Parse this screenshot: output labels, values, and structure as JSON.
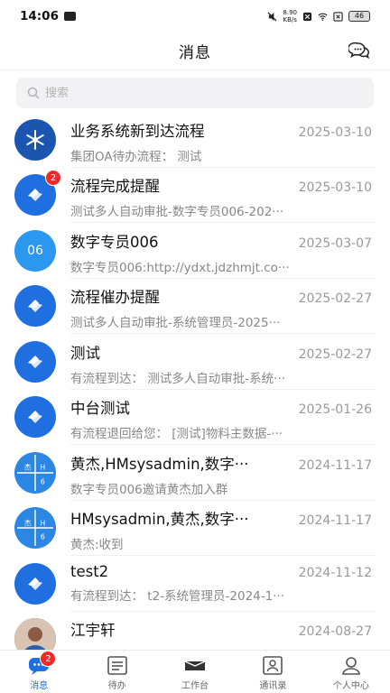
{
  "status_bar": {
    "time": "14:06",
    "speed_value": "8.90",
    "speed_unit": "KB/s",
    "battery": "46"
  },
  "header": {
    "title": "消息"
  },
  "search": {
    "placeholder": "搜索"
  },
  "messages": [
    {
      "title": "业务系统新到达流程",
      "date": "2025-03-10",
      "preview": "集团OA待办流程： 测试",
      "avatar": "snowflake",
      "badge": ""
    },
    {
      "title": "流程完成提醒",
      "date": "2025-03-10",
      "preview": "测试多人自动审批-数字专员006-202···",
      "avatar": "app-logo",
      "badge": "2"
    },
    {
      "title": "数字专员006",
      "date": "2025-03-07",
      "preview": "数字专员006:http://ydxt.jdzhmjt.co···",
      "avatar": "06",
      "badge": ""
    },
    {
      "title": "流程催办提醒",
      "date": "2025-02-27",
      "preview": "测试多人自动审批-系统管理员-2025···",
      "avatar": "app-logo",
      "badge": ""
    },
    {
      "title": "测试",
      "date": "2025-02-27",
      "preview": "有流程到达： 测试多人自动审批-系统···",
      "avatar": "app-logo",
      "badge": ""
    },
    {
      "title": "中台测试",
      "date": "2025-01-26",
      "preview": "有流程退回给您： [测试]物料主数据-···",
      "avatar": "app-logo",
      "badge": ""
    },
    {
      "title": "黄杰,HMsysadmin,数字···",
      "date": "2024-11-17",
      "preview": "数字专员006邀请黄杰加入群",
      "avatar": "group",
      "badge": ""
    },
    {
      "title": "HMsysadmin,黄杰,数字···",
      "date": "2024-11-17",
      "preview": "黄杰:收到",
      "avatar": "group",
      "badge": ""
    },
    {
      "title": "test2",
      "date": "2024-11-12",
      "preview": "有流程到达： t2-系统管理员-2024-1···",
      "avatar": "app-logo",
      "badge": ""
    },
    {
      "title": "江宇轩",
      "date": "2024-08-27",
      "preview": "",
      "avatar": "photo",
      "badge": ""
    }
  ],
  "group_avatar_labels": {
    "top_left": "杰",
    "top_right": "H",
    "bottom_right": "6"
  },
  "tabbar": {
    "tabs": [
      {
        "label": "消息",
        "icon": "chat-icon",
        "badge": "2"
      },
      {
        "label": "待办",
        "icon": "todo-icon",
        "badge": ""
      },
      {
        "label": "工作台",
        "icon": "workbench-icon",
        "badge": ""
      },
      {
        "label": "通讯录",
        "icon": "contacts-icon",
        "badge": ""
      },
      {
        "label": "个人中心",
        "icon": "profile-icon",
        "badge": ""
      }
    ]
  },
  "colors": {
    "accent": "#1f6fe0",
    "badge": "#ee2a2a",
    "muted_text": "#888888"
  }
}
